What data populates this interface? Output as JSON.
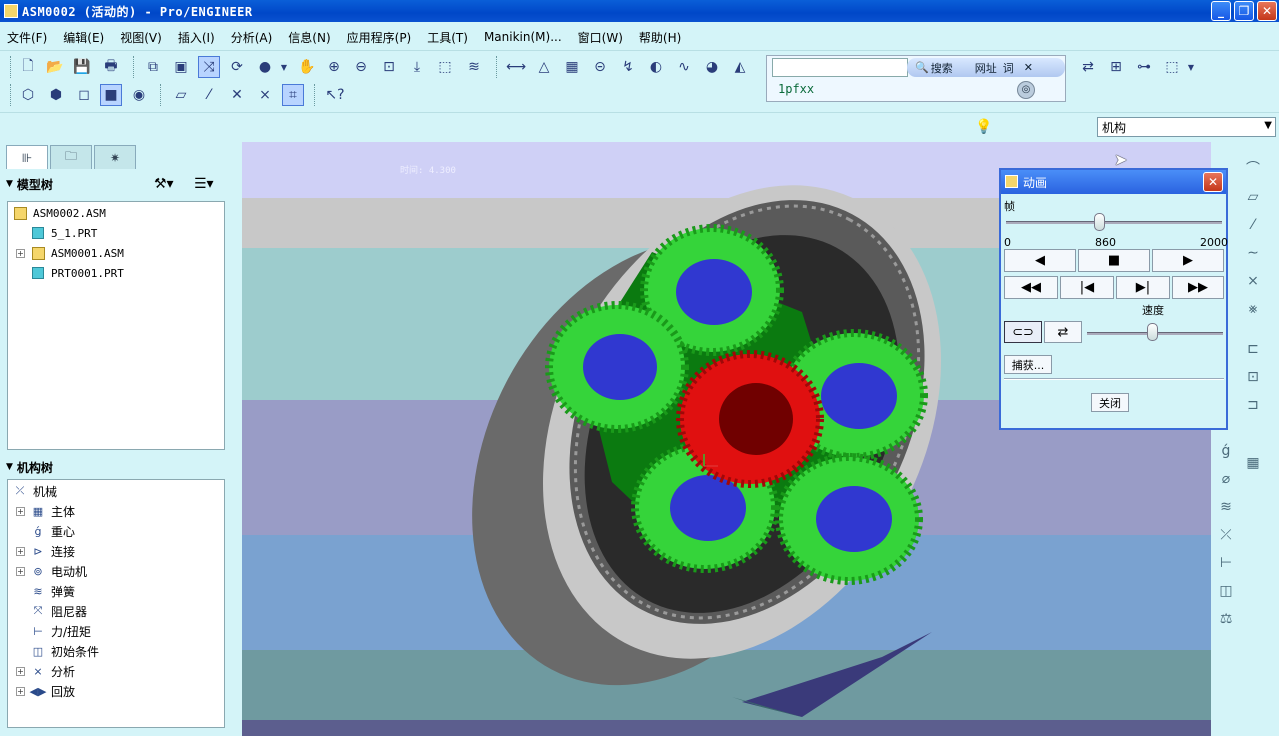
{
  "window": {
    "title": "ASM0002 (活动的) - Pro/ENGINEER",
    "minimize": "_",
    "maximize": "❐",
    "close": "✕"
  },
  "menu": [
    "文件(F)",
    "编辑(E)",
    "视图(V)",
    "插入(I)",
    "分析(A)",
    "信息(N)",
    "应用程序(P)",
    "工具(T)",
    "Manikin(M)...",
    "窗口(W)",
    "帮助(H)"
  ],
  "search": {
    "placeholder": "",
    "search_label": "搜索",
    "tab_url": "网址",
    "tab_word": "词",
    "value": "1pfxx"
  },
  "filter": {
    "selected": "机构"
  },
  "panel_tabs": [
    "model-tree-tab",
    "layer-tree-tab",
    "favorites-tab"
  ],
  "model_tree": {
    "header": "模型树",
    "items": [
      {
        "label": "ASM0002.ASM",
        "icon": "assembly-icon",
        "level": 0,
        "expandable": false
      },
      {
        "label": "5_1.PRT",
        "icon": "part-icon",
        "level": 1,
        "expandable": false
      },
      {
        "label": "ASM0001.ASM",
        "icon": "assembly-icon",
        "level": 1,
        "expandable": true
      },
      {
        "label": "PRT0001.PRT",
        "icon": "part-icon",
        "level": 1,
        "expandable": false
      }
    ]
  },
  "mech_tree": {
    "header": "机构树",
    "items": [
      {
        "label": "机械",
        "icon": "mechanism-icon",
        "level": 0,
        "expandable": false
      },
      {
        "label": "主体",
        "icon": "body-icon",
        "level": 1,
        "expandable": true
      },
      {
        "label": "重心",
        "icon": "gravity-icon",
        "level": 1,
        "expandable": false
      },
      {
        "label": "连接",
        "icon": "connection-icon",
        "level": 1,
        "expandable": true
      },
      {
        "label": "电动机",
        "icon": "motor-icon",
        "level": 1,
        "expandable": true
      },
      {
        "label": "弹簧",
        "icon": "spring-icon",
        "level": 1,
        "expandable": false
      },
      {
        "label": "阻尼器",
        "icon": "damper-icon",
        "level": 1,
        "expandable": false
      },
      {
        "label": "力/扭矩",
        "icon": "force-icon",
        "level": 1,
        "expandable": false
      },
      {
        "label": "初始条件",
        "icon": "initial-condition-icon",
        "level": 1,
        "expandable": false
      },
      {
        "label": "分析",
        "icon": "analysis-icon",
        "level": 1,
        "expandable": true
      },
      {
        "label": "回放",
        "icon": "playback-icon",
        "level": 1,
        "expandable": true
      }
    ]
  },
  "viewport": {
    "time_label": "时间: 4.300"
  },
  "animation": {
    "title": "动画",
    "frame_label": "帧",
    "frame_min": "0",
    "frame_value": "860",
    "frame_max": "2000",
    "frame_position": 0.43,
    "speed_label": "速度",
    "speed_position": 0.48,
    "capture_label": "捕获...",
    "close_label": "关闭"
  },
  "colors": {
    "gear_green": "#35d43a",
    "gear_dark_green": "#0b7a10",
    "sun_gear_red": "#e01010",
    "hub_blue": "#3038d0",
    "ring_gray": "#c8c8c8",
    "housing_gray": "#6a6a6a",
    "title_blue": "#0a52d0"
  }
}
